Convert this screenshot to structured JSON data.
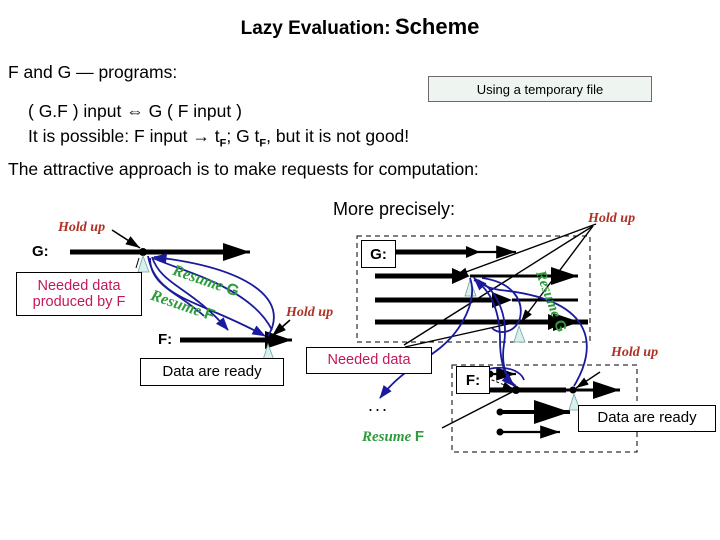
{
  "slide": {
    "title_part1": "Lazy Evaluation:",
    "title_part2": "Scheme",
    "body": {
      "line1": "F and G — programs:",
      "line2": "( G.F ) input ⇔ G ( F input )",
      "line3_a": "It is possible: F input → t",
      "line3_sub1": "F",
      "line3_b": "; G t",
      "line3_sub2": "F",
      "line3_c": ", but it is not good!",
      "line4": "The attractive approach is to make requests for computation:"
    },
    "temp_file_callout": "Using a temporary file",
    "more_precisely": "More precisely:"
  },
  "left_diagram": {
    "g_label": "G:",
    "f_label": "F:",
    "hold_up_1": "Hold up",
    "hold_up_2": "Hold up",
    "needed_data_line1": "Needed data",
    "needed_data_line2": "produced by F",
    "data_ready": "Data are ready",
    "resume_g": "Resume ",
    "resume_g_bold": "G",
    "resume_f": "Resume ",
    "resume_f_bold": "F"
  },
  "right_diagram": {
    "g_label": "G:",
    "f_label": "F:",
    "hold_up_top": "Hold up",
    "hold_up_bottom": "Hold up",
    "needed_data": "Needed data",
    "data_ready": "Data are ready",
    "resume_g": "Resume ",
    "resume_g_bold": "G",
    "resume_f": "Resume ",
    "resume_f_bold": "F",
    "ellipsis": "..."
  },
  "colors": {
    "hold_up": "#b03024",
    "resume": "#2e9c3c",
    "needed_data": "#c2185b",
    "curve": "#1a1a9c",
    "callout_fill": "#eef5f0",
    "arrow": "#000000"
  }
}
